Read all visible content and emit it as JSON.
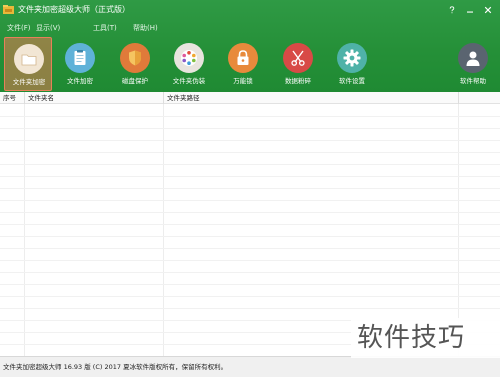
{
  "window": {
    "title": "文件夹加密超级大师（正式版）",
    "icon": "app-logo-icon"
  },
  "menu": [
    {
      "label": "文件(F)"
    },
    {
      "label": "显示(V)"
    },
    {
      "label": "工具(T)"
    },
    {
      "label": "帮助(H)"
    }
  ],
  "toolbar": [
    {
      "label": "文件夹加密",
      "icon": "folder-icon",
      "color": "#f2e6d4",
      "active": true
    },
    {
      "label": "文件加密",
      "icon": "document-icon",
      "color": "#5fb2d8"
    },
    {
      "label": "磁盘保护",
      "icon": "shield-icon",
      "color": "#e07a3a"
    },
    {
      "label": "文件夹伪装",
      "icon": "palette-icon",
      "color": "#e8e4de"
    },
    {
      "label": "万能锁",
      "icon": "lock-icon",
      "color": "#e88a3c"
    },
    {
      "label": "数据粉碎",
      "icon": "scissors-icon",
      "color": "#d84a46"
    },
    {
      "label": "软件设置",
      "icon": "gear-icon",
      "color": "#4fb2a8"
    },
    {
      "label": "软件帮助",
      "icon": "user-help-icon",
      "color": "#5a6470"
    }
  ],
  "table": {
    "columns": [
      "序号",
      "文件夹名",
      "文件夹路径"
    ]
  },
  "status": {
    "text": "文件夹加密超级大师 16.93 版 (C) 2017  夏冰软件版权所有，保留所有权利。"
  },
  "watermark": "软件技巧",
  "colors": {
    "toolbar_green": "#259038",
    "active_tool": "#e7805a"
  }
}
